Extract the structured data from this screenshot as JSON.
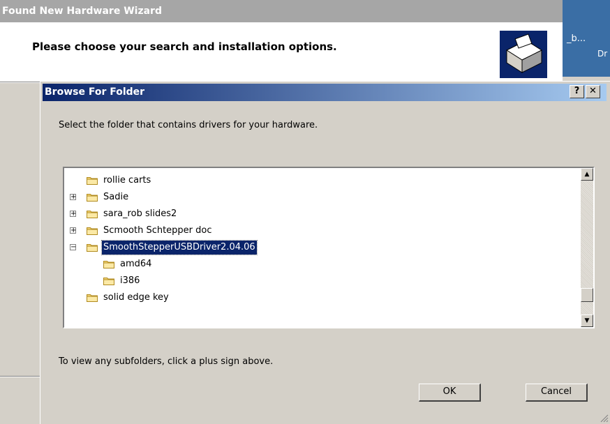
{
  "wizard": {
    "title": "Found New Hardware Wizard",
    "header": "Please choose your search and installation options."
  },
  "side_panel": {
    "text1": "_b...",
    "text2": "Dr"
  },
  "browse": {
    "title": "Browse For Folder",
    "help_label": "?",
    "close_label": "✕",
    "instruction": "Select the folder that contains drivers for your hardware.",
    "hint": "To view any subfolders, click a plus sign above.",
    "ok_label": "OK",
    "cancel_label": "Cancel"
  },
  "tree": {
    "items": [
      {
        "label": "rollie carts",
        "expander": "",
        "indent": 0
      },
      {
        "label": "Sadie",
        "expander": "+",
        "indent": 0
      },
      {
        "label": "sara_rob slides2",
        "expander": "+",
        "indent": 0
      },
      {
        "label": "Scmooth Schtepper doc",
        "expander": "+",
        "indent": 0
      },
      {
        "label": "SmoothStepperUSBDriver2.04.06",
        "expander": "−",
        "indent": 0,
        "selected": true
      },
      {
        "label": "amd64",
        "expander": "",
        "indent": 1
      },
      {
        "label": "i386",
        "expander": "",
        "indent": 1
      },
      {
        "label": "solid edge key",
        "expander": "",
        "indent": 0
      }
    ]
  },
  "colors": {
    "title_active": "#0a246a",
    "title_inactive": "#a6a6a6",
    "desktop_blue": "#3a6ea5",
    "folder_yellow": "#f6d77a"
  }
}
